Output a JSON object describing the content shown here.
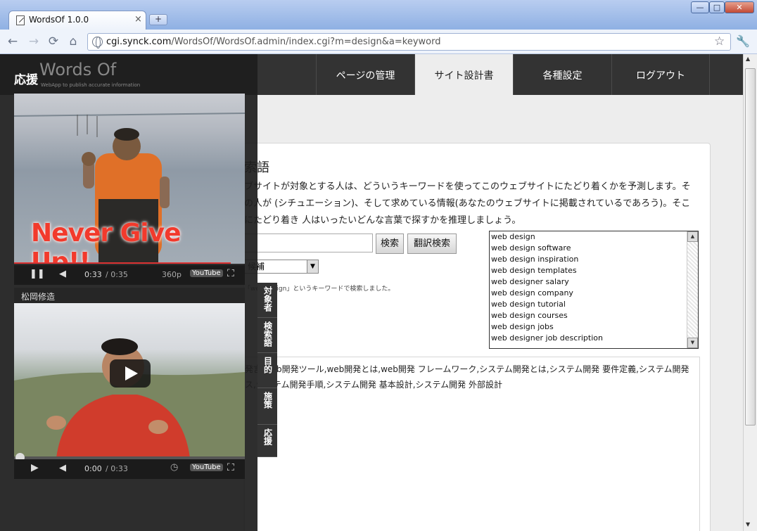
{
  "browser": {
    "tab_title": "WordsOf 1.0.0",
    "tab_close": "×",
    "new_tab": "+",
    "window_buttons": {
      "minimize": "—",
      "maximize": "□",
      "close": "✕"
    },
    "nav": {
      "back": "←",
      "forward": "→",
      "reload": "⟳",
      "home": "⌂"
    },
    "url_domain": "cgi.synck.com",
    "url_path": "/WordsOf/WordsOf.admin/index.cgi?m=design&a=keyword",
    "star": "☆",
    "wrench": "🔧"
  },
  "site": {
    "logo_text": "Words Of",
    "logo_sub": "WebApp to publish accurate information",
    "nav": [
      {
        "label": "ページの管理",
        "active": false
      },
      {
        "label": "サイト設計書",
        "active": true
      },
      {
        "label": "各種設定",
        "active": false
      },
      {
        "label": "ログアウト",
        "active": false
      }
    ]
  },
  "main": {
    "title": "索語",
    "description": "ブサイトが対象とする人は、どういうキーワードを使ってこのウェブサイトにたどり着くかを予測します。その人が (シチュエーション)、そして求めている情報(あなたのウェブサイトに掲載されているであろう)。そこにたどり着き 人はいったいどんな言葉で探すかを推理しましょう。",
    "search_placeholder": "",
    "search_button": "検索",
    "translate_search_button": "翻訳検索",
    "select_value": "候補",
    "note": "「web design」というキーワードで検索しました。",
    "suggestions": [
      "web design",
      "web design software",
      "web design inspiration",
      "web design templates",
      "web designer salary",
      "web design company",
      "web design tutorial",
      "web design courses",
      "web design jobs",
      "web designer job description"
    ],
    "keywords_text": "発言,web開発ツール,web開発とは,web開発 フレームワーク,システム開発とは,システム開発 要件定義,システム開発 ス,システム開発手順,システム開発 基本設計,システム開発 外部設計"
  },
  "panel": {
    "title": "応援",
    "video1": {
      "caption": "Never Give Up!!",
      "time_current": "0:33",
      "time_total": "/ 0:35",
      "quality": "360p",
      "youtube": "YouTube",
      "progress": 0.94
    },
    "video2": {
      "title": "松岡修造",
      "time_current": "0:00",
      "time_total": "/ 0:33",
      "youtube": "YouTube",
      "progress": 0
    },
    "side_tabs": [
      "対象者",
      "検索語",
      "目的",
      "施策",
      "応援"
    ]
  },
  "colors": {
    "header": "#333333",
    "page_bg": "#ededed",
    "accent_red": "#e23b2e"
  }
}
